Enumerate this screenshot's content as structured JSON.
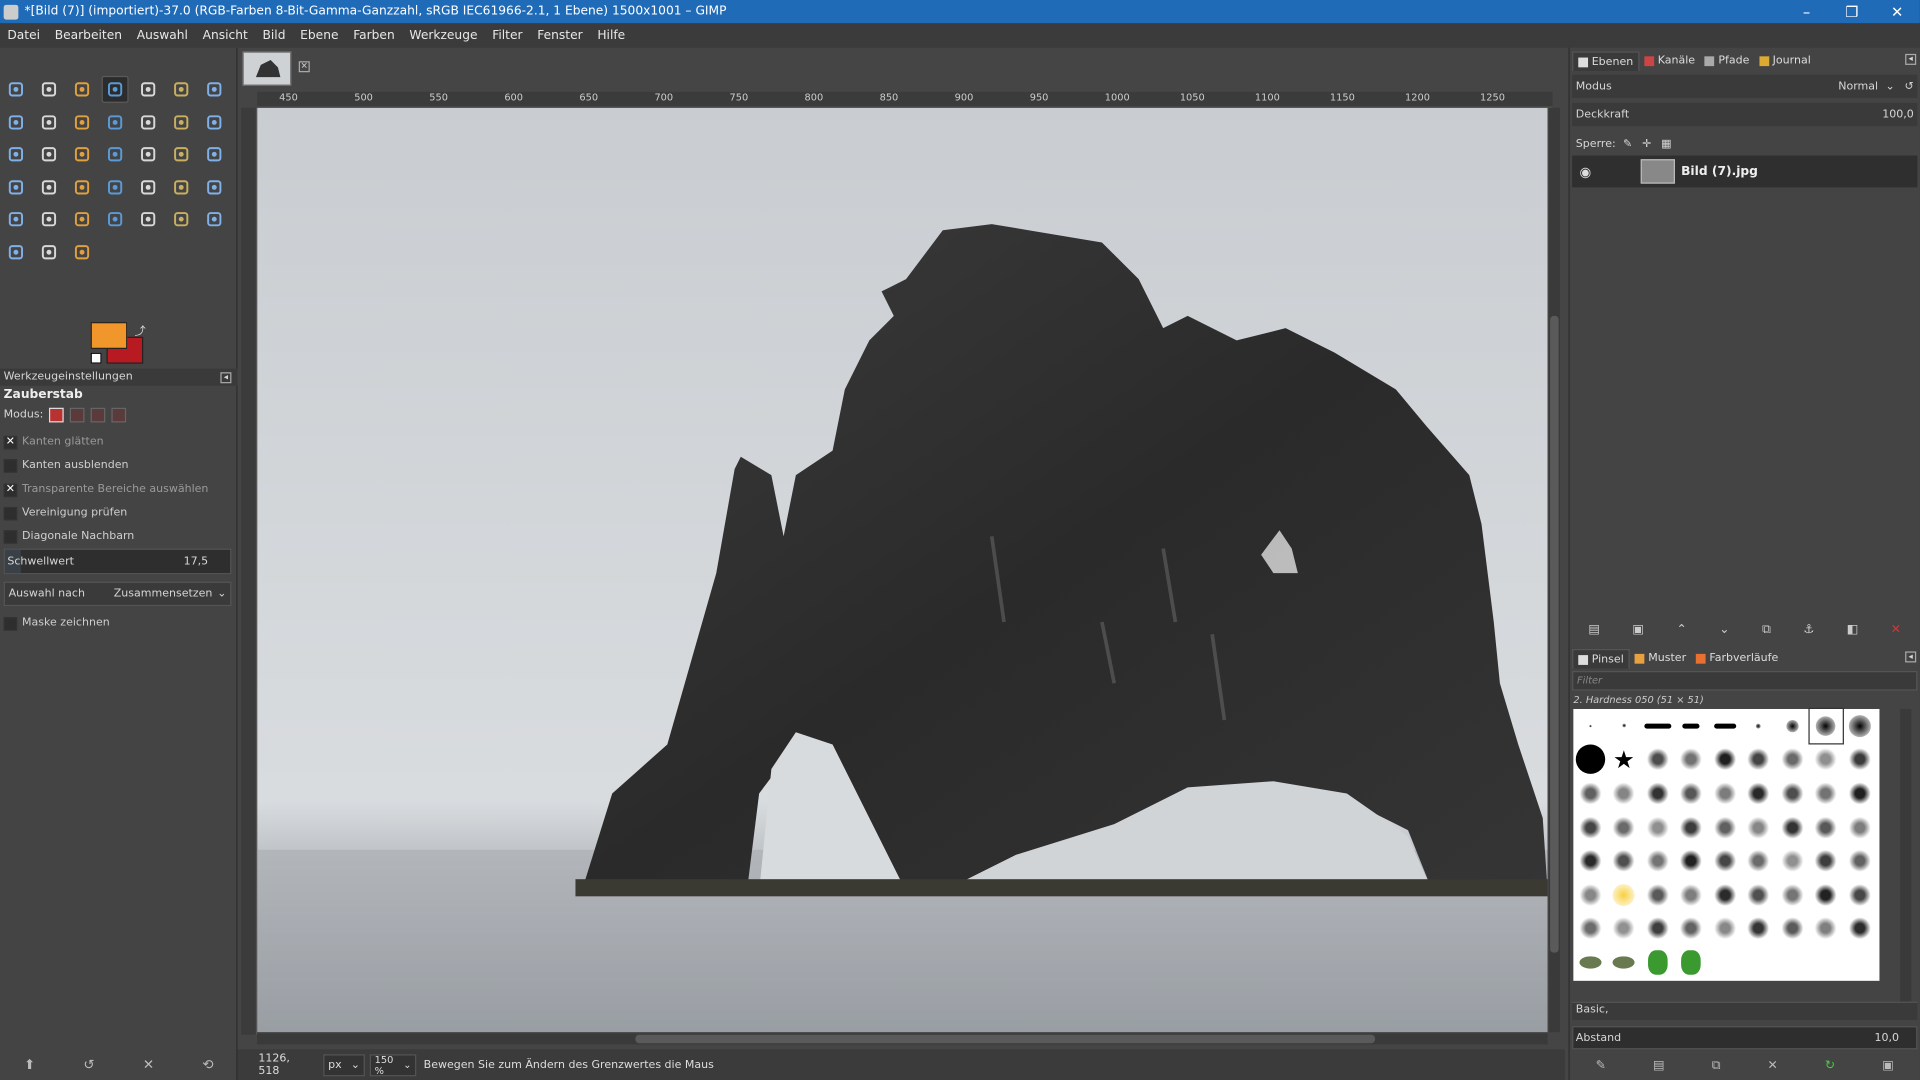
{
  "window": {
    "title": "*[Bild (7)] (importiert)-37.0 (RGB-Farben 8-Bit-Gamma-Ganzzahl, sRGB IEC61966-2.1, 1 Ebene) 1500x1001 – GIMP",
    "controls": [
      "–",
      "❐",
      "✕"
    ]
  },
  "menu": [
    "Datei",
    "Bearbeiten",
    "Auswahl",
    "Ansicht",
    "Bild",
    "Ebene",
    "Farben",
    "Werkzeuge",
    "Filter",
    "Fenster",
    "Hilfe"
  ],
  "colors": {
    "foreground": "#f0962a",
    "background": "#b81a22",
    "accent": "#1f6bb8"
  },
  "toolbox": {
    "tools": [
      "rect-select-icon",
      "ellipse-select-icon",
      "lasso-icon",
      "magic-wand-icon",
      "select-by-color-icon",
      "scissors-select-icon",
      "foreground-select-icon",
      "pointer-icon",
      "color-picker-icon",
      "zoom-icon",
      "measure-icon",
      "move-icon",
      "align-icon",
      "crop-icon",
      "unified-transform-icon",
      "rotate-icon",
      "scale-icon",
      "shear-icon",
      "flip-icon",
      "perspective-icon",
      "3d-transform-icon",
      "cage-transform-icon",
      "warp-icon",
      "text-icon",
      "bucket-fill-icon",
      "gradient-icon",
      "pencil-icon",
      "paintbrush-icon",
      "eraser-icon",
      "airbrush-icon",
      "ink-icon",
      "mypaint-brush-icon",
      "clone-icon",
      "heal-icon",
      "perspective-clone-icon",
      "blur-icon",
      "smudge-icon",
      "dodge-burn-icon"
    ],
    "active_tool_index": 3,
    "options_header": "Werkzeugeinstellungen",
    "tool_name": "Zauberstab",
    "mode_label": "Modus:",
    "options": [
      {
        "label": "Kanten glätten",
        "checked": true
      },
      {
        "label": "Kanten ausblenden",
        "checked": false
      },
      {
        "label": "Transparente Bereiche auswählen",
        "checked": true
      },
      {
        "label": "Vereinigung prüfen",
        "checked": false
      },
      {
        "label": "Diagonale Nachbarn",
        "checked": false
      }
    ],
    "threshold_label": "Schwellwert",
    "threshold_value": "17,5",
    "threshold_fraction": 0.07,
    "select_by_label": "Auswahl nach",
    "select_by_value": "Zusammensetzen",
    "draw_mask_label": "Maske zeichnen",
    "footer_icons": [
      "save-preset-icon",
      "restore-icon",
      "delete-icon",
      "reset-icon"
    ]
  },
  "ruler": {
    "labels": [
      "450",
      "500",
      "550",
      "600",
      "650",
      "700",
      "750",
      "800",
      "850",
      "900",
      "950",
      "1000",
      "1050",
      "1100",
      "1150",
      "1200",
      "1250"
    ]
  },
  "status": {
    "coords": "1126, 518",
    "unit": "px",
    "zoom": "150 %",
    "message": "Bewegen Sie zum Ändern des Grenzwertes die Maus"
  },
  "layers_dock": {
    "tabs": [
      "Ebenen",
      "Kanäle",
      "Pfade",
      "Journal"
    ],
    "mode_label": "Modus",
    "mode_value": "Normal",
    "opacity_label": "Deckkraft",
    "opacity_value": "100,0",
    "lock_label": "Sperre:",
    "layer_name": "Bild (7).jpg"
  },
  "brushes_dock": {
    "tabs": [
      "Pinsel",
      "Muster",
      "Farbverläufe"
    ],
    "filter_placeholder": "Filter",
    "selected_brush": "2. Hardness 050 (51 × 51)",
    "preset": "Basic,",
    "spacing_label": "Abstand",
    "spacing_value": "10,0"
  }
}
